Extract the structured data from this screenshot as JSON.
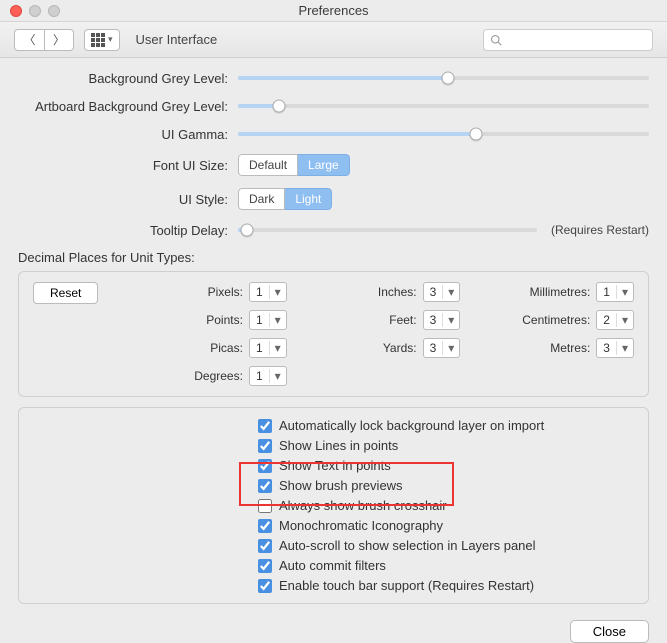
{
  "window": {
    "title": "Preferences",
    "section": "User Interface",
    "search_placeholder": ""
  },
  "sliders": {
    "bg": {
      "label": "Background Grey Level:",
      "pct": 51
    },
    "artbg": {
      "label": "Artboard Background Grey Level:",
      "pct": 10
    },
    "gamma": {
      "label": "UI Gamma:",
      "pct": 58
    },
    "fontui": {
      "label": "Font UI Size:",
      "opt_a": "Default",
      "opt_b": "Large"
    },
    "style": {
      "label": "UI Style:",
      "opt_a": "Dark",
      "opt_b": "Light"
    },
    "tooltip": {
      "label": "Tooltip Delay:",
      "pct": 3,
      "hint": "(Requires Restart)"
    }
  },
  "decimal": {
    "heading": "Decimal Places for Unit Types:",
    "reset": "Reset",
    "pixels": {
      "label": "Pixels:",
      "val": "1"
    },
    "points": {
      "label": "Points:",
      "val": "1"
    },
    "picas": {
      "label": "Picas:",
      "val": "1"
    },
    "degrees": {
      "label": "Degrees:",
      "val": "1"
    },
    "inches": {
      "label": "Inches:",
      "val": "3"
    },
    "feet": {
      "label": "Feet:",
      "val": "3"
    },
    "yards": {
      "label": "Yards:",
      "val": "3"
    },
    "mm": {
      "label": "Millimetres:",
      "val": "1"
    },
    "cm": {
      "label": "Centimetres:",
      "val": "2"
    },
    "m": {
      "label": "Metres:",
      "val": "3"
    }
  },
  "checks": {
    "c1": "Automatically lock background layer on import",
    "c2": "Show Lines in points",
    "c3": "Show Text in points",
    "c4": "Show brush previews",
    "c5": "Always show brush crosshair",
    "c6": "Monochromatic Iconography",
    "c7": "Auto-scroll to show selection in Layers panel",
    "c8": "Auto commit filters",
    "c9": "Enable touch bar support (Requires Restart)"
  },
  "footer": {
    "close": "Close"
  }
}
